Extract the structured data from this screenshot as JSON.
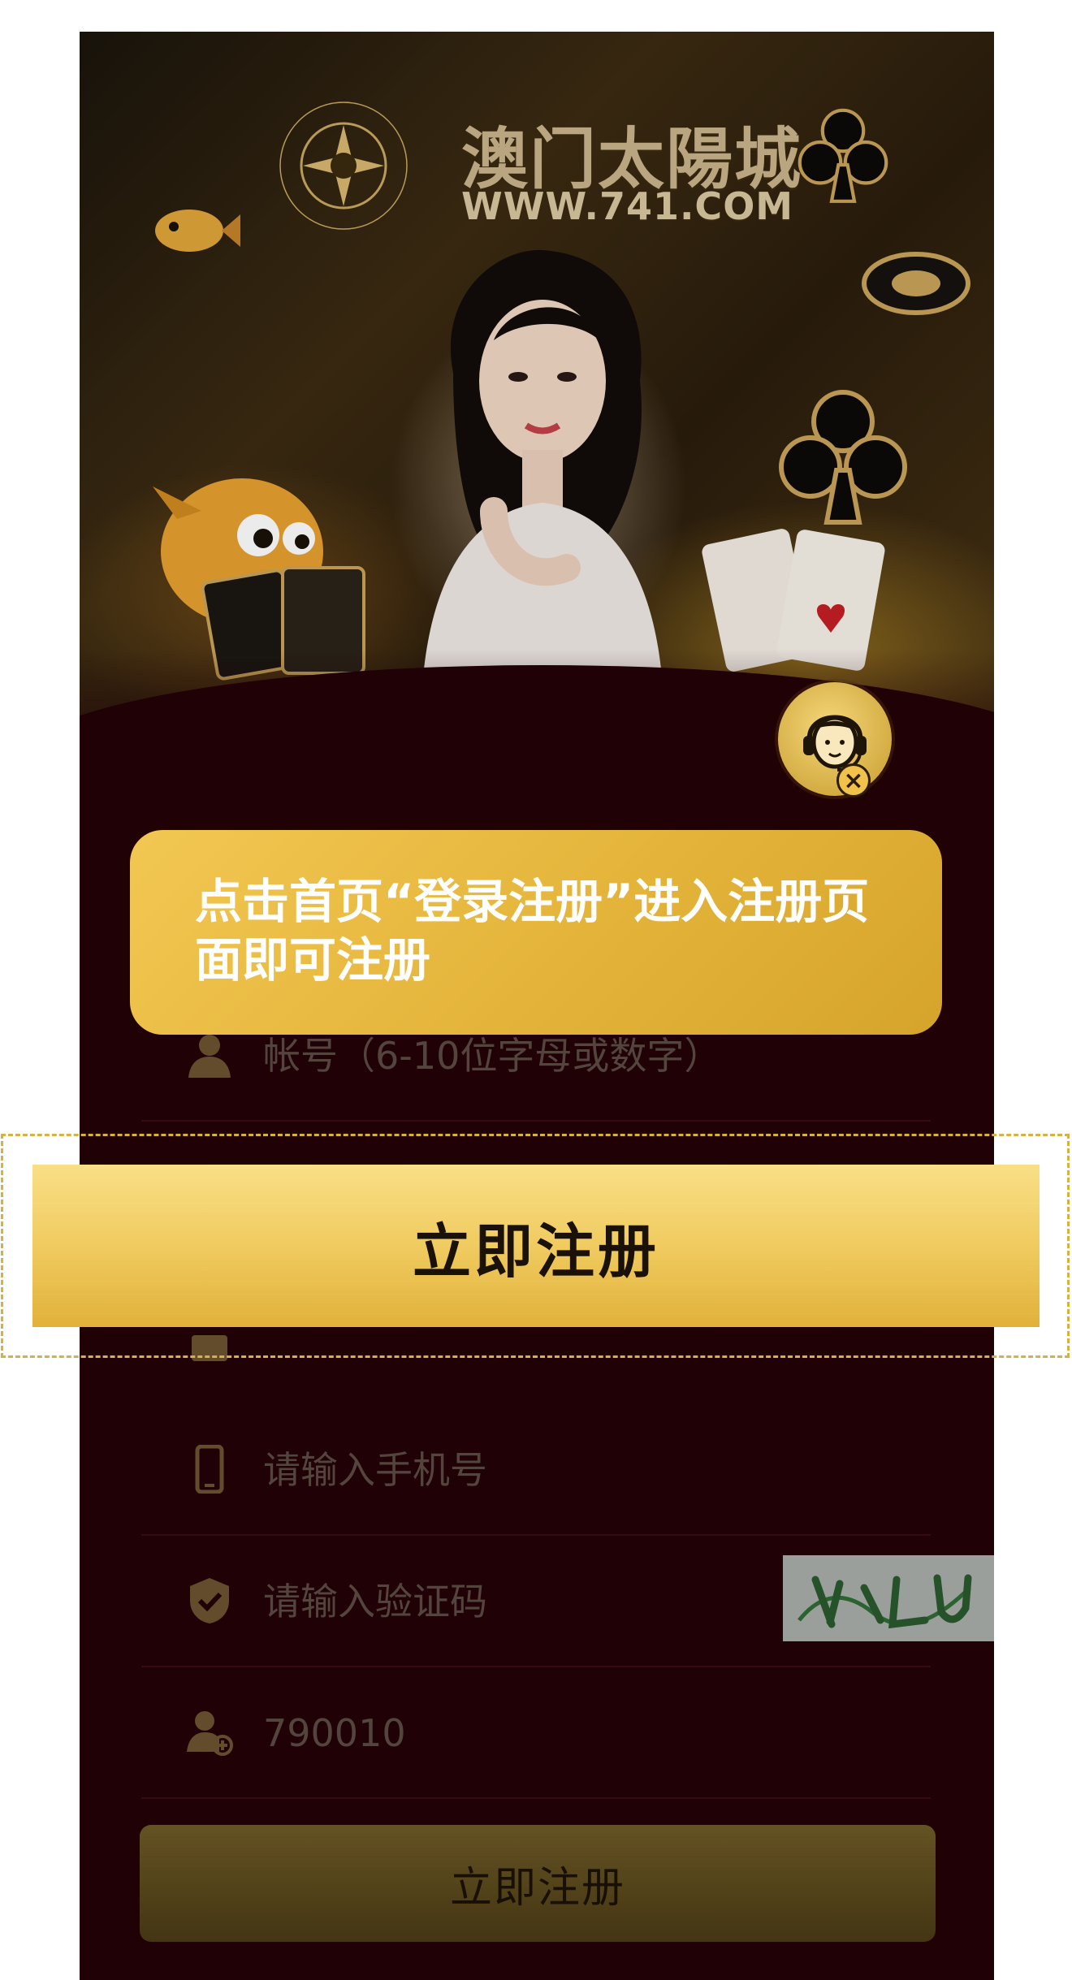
{
  "brand": {
    "title": "澳门太陽城",
    "url": "WWW.741.COM"
  },
  "tour": {
    "tooltip": "点击首页“登录注册”进入注册页面即可注册",
    "highlight_button": "立即注册"
  },
  "form": {
    "account_placeholder": "帐号（6-10位字母或数字）",
    "phone_placeholder": "请输入手机号",
    "captcha_placeholder": "请输入验证码",
    "invite_code_value": "790010",
    "submit_label": "立即注册"
  },
  "colors": {
    "page_bg": "#230207",
    "gold": "#e4b43a",
    "icon": "#6b5330"
  }
}
